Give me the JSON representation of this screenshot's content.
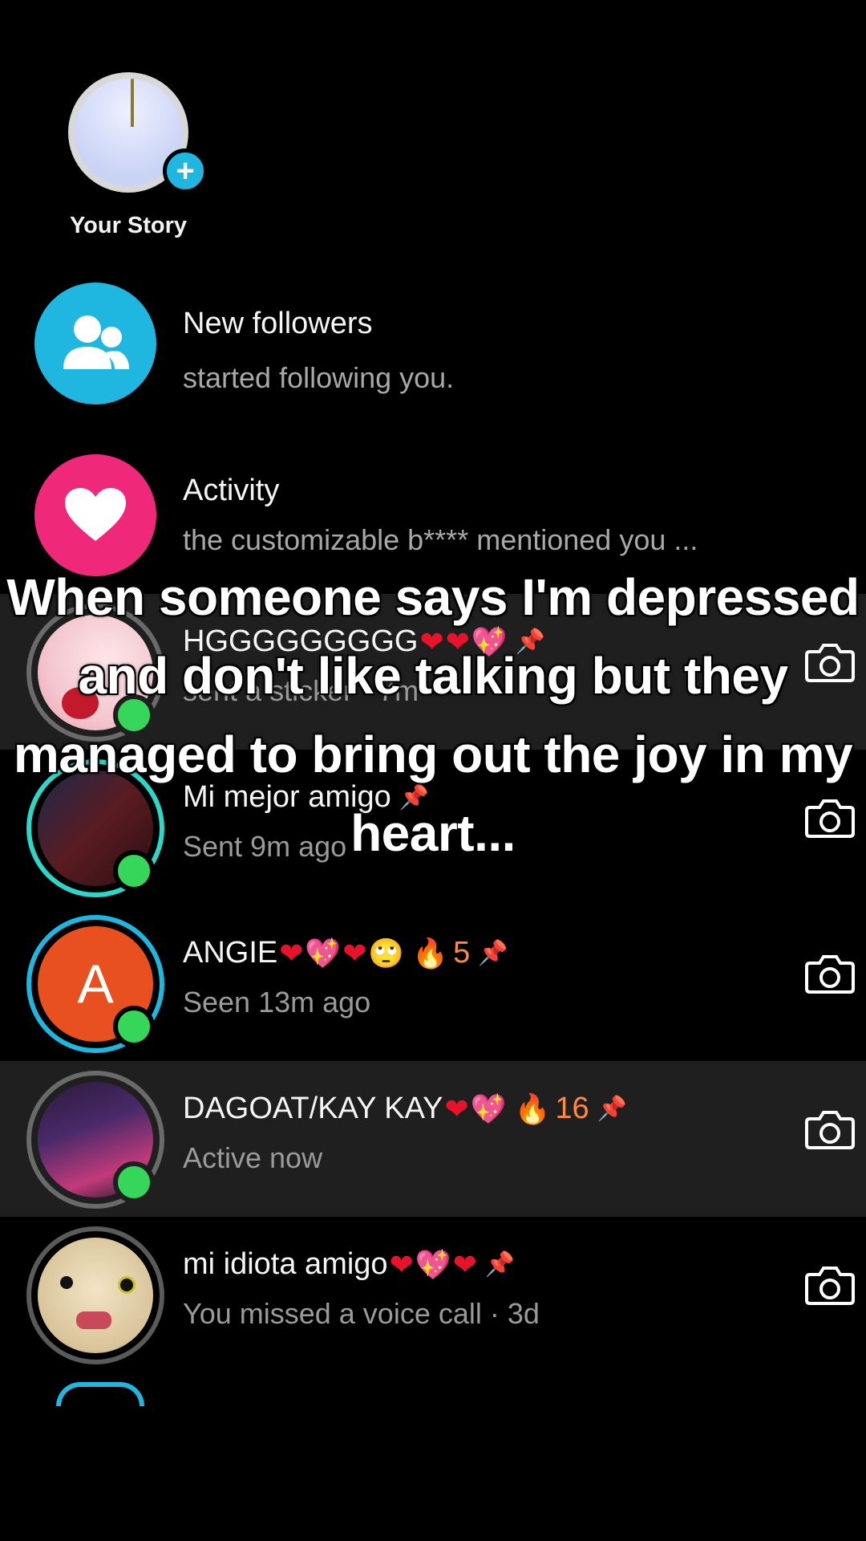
{
  "story": {
    "label": "Your Story"
  },
  "inbox": {
    "new_followers": {
      "title": "New followers",
      "subtitle": "started following you."
    },
    "activity": {
      "title": "Activity",
      "subtitle": "the customizable b**** mentioned you ..."
    }
  },
  "chats": [
    {
      "name": "HGGGGGGGGG",
      "status": "sent a sticker · 7m"
    },
    {
      "name": "Mi mejor amigo",
      "status": "Sent 9m ago"
    },
    {
      "name": "ANGIE",
      "status": "Seen 13m ago",
      "avatar_letter": "A",
      "streak": "5"
    },
    {
      "name": "DAGOAT/KAY KAY",
      "status": "Active now",
      "streak": "16"
    },
    {
      "name": "mi idiota amigo",
      "status": "You missed a voice call · 3d"
    }
  ],
  "overlay_caption": "When someone says I'm depressed and don't like talking but they managed to bring out the joy in my heart...",
  "colors": {
    "followers_blue": "#1fb6e0",
    "activity_pink": "#f0287a",
    "online_green": "#36d65b",
    "active_ring": "#2fd6c8",
    "angie_orange": "#e8501f"
  },
  "icons": [
    "plus-icon",
    "people-icon",
    "heart-icon",
    "camera-icon",
    "pin-icon",
    "fire-icon"
  ]
}
